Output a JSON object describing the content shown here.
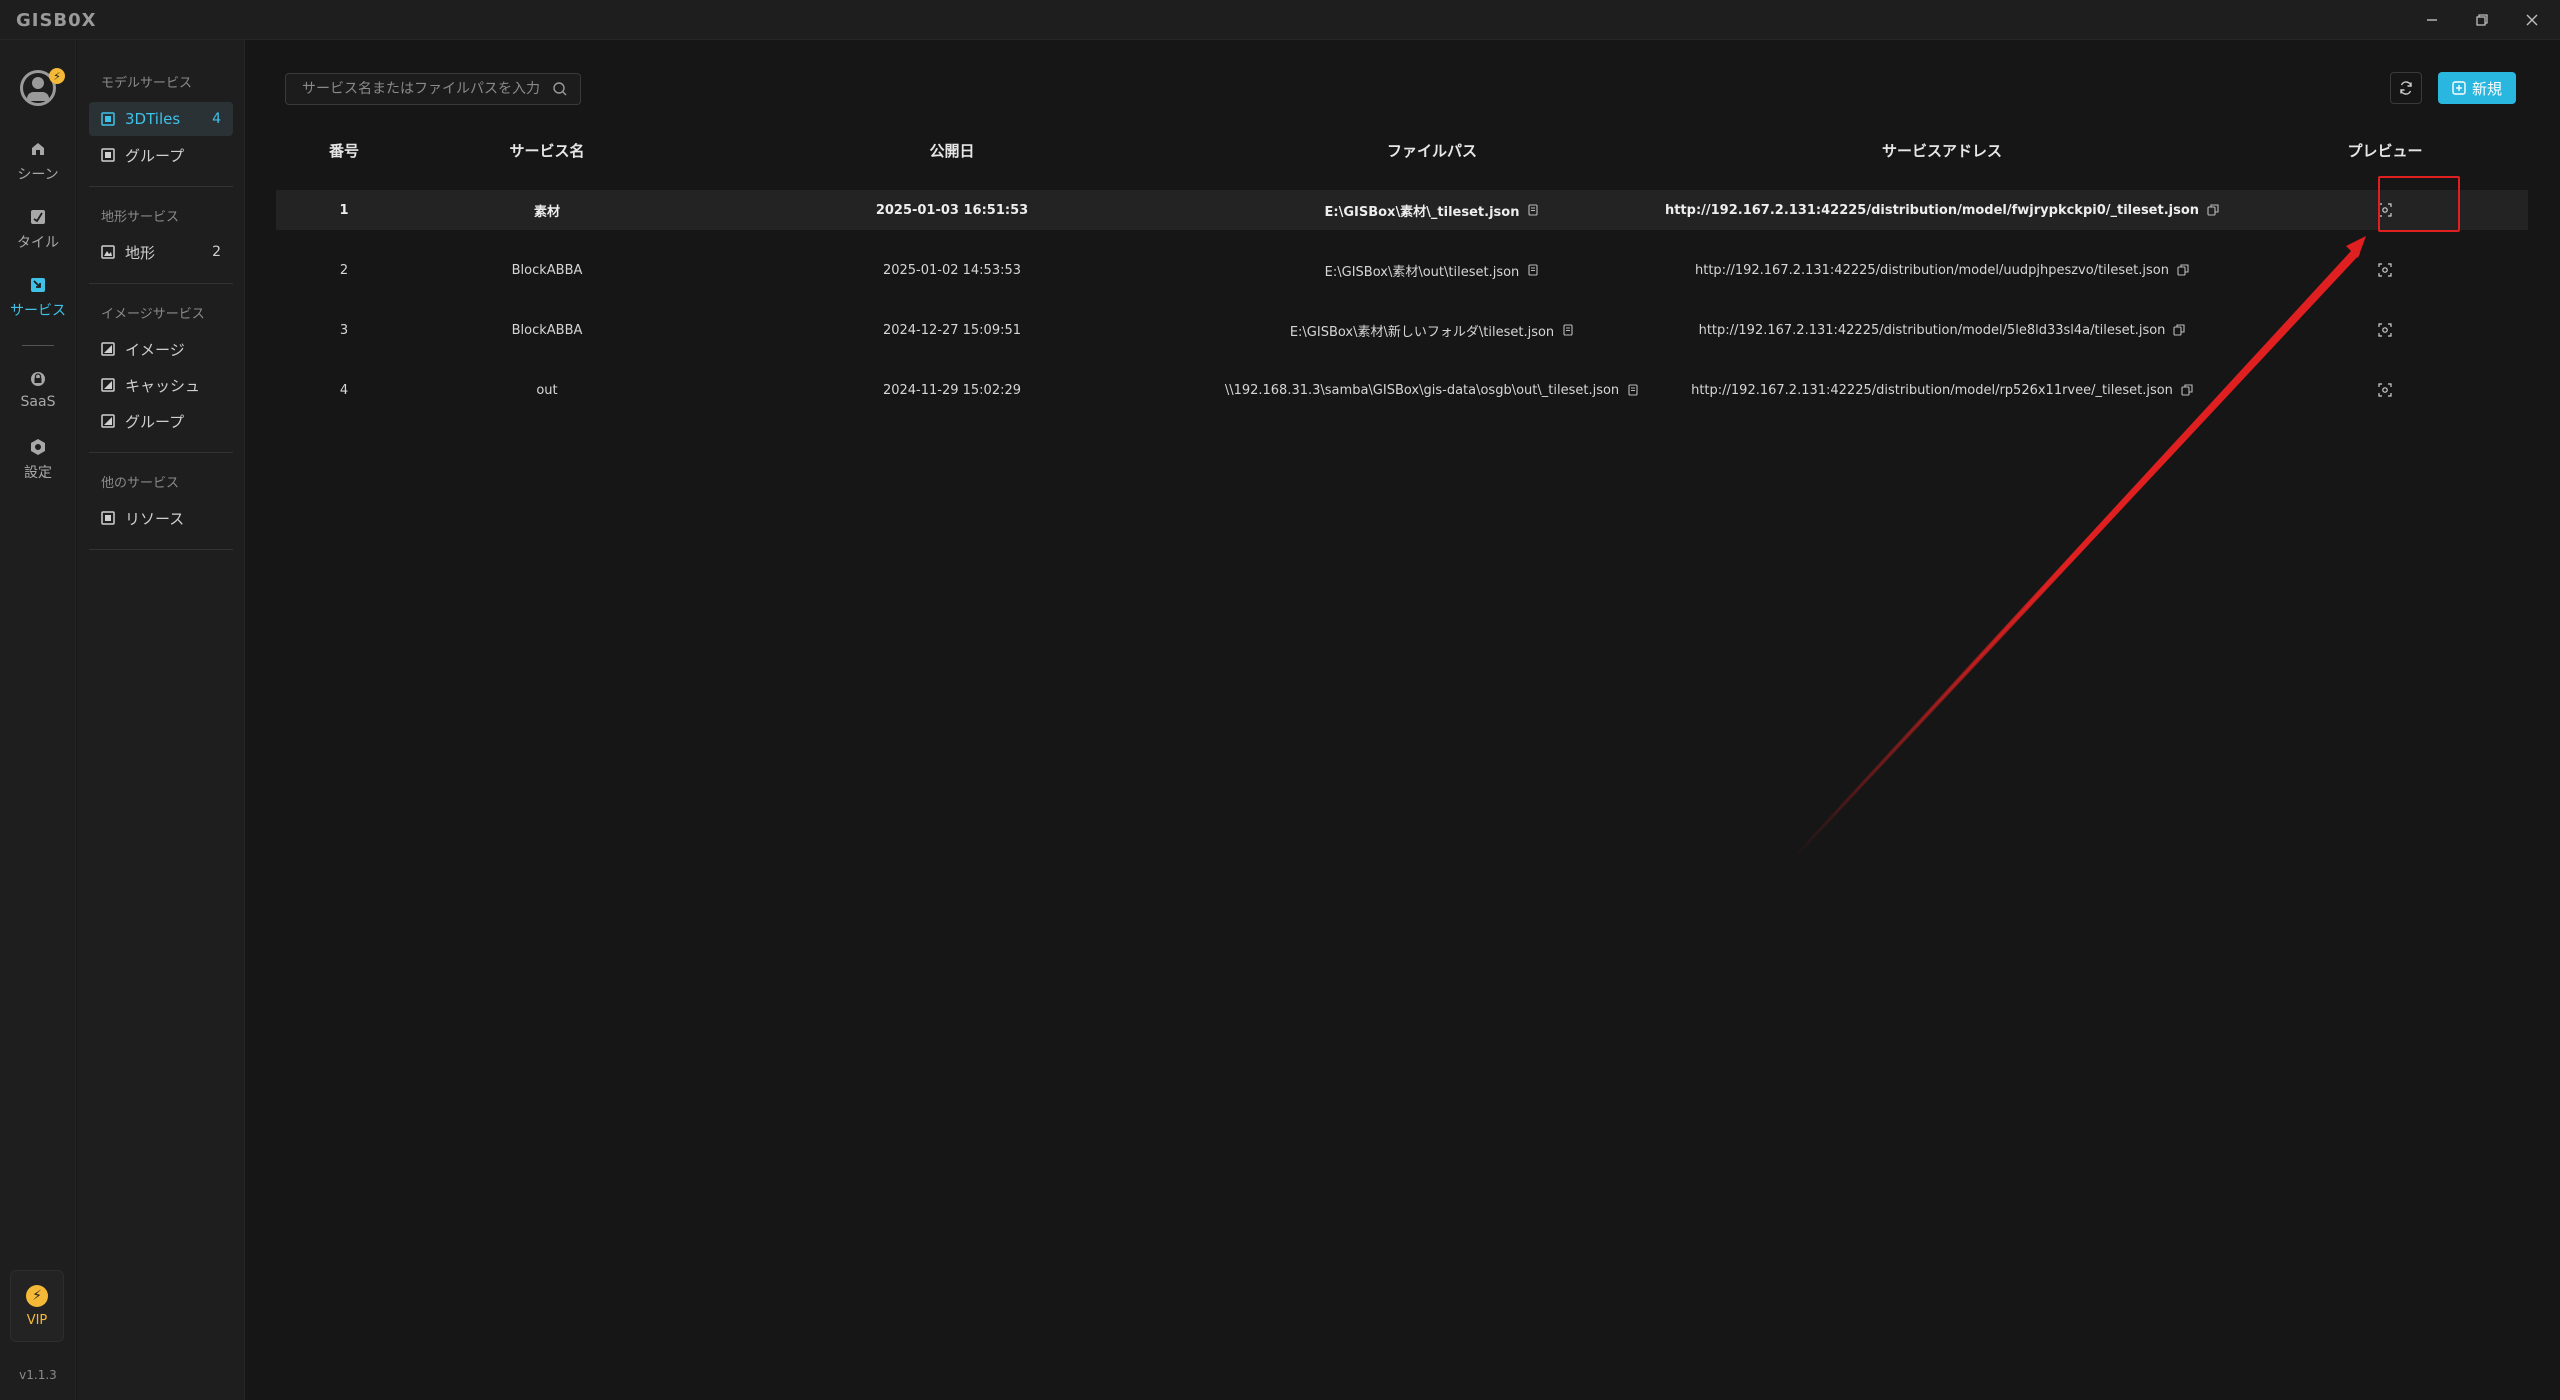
{
  "app": {
    "logo": "GISB0X",
    "version": "v1.1.3",
    "vip_label": "VIP",
    "avatar_badge": "⚡"
  },
  "rail": {
    "items": [
      {
        "label": "シーン",
        "icon": "scene-icon"
      },
      {
        "label": "タイル",
        "icon": "tile-icon"
      },
      {
        "label": "サービス",
        "icon": "service-icon",
        "active": true
      },
      {
        "label": "SaaS",
        "icon": "saas-icon"
      },
      {
        "label": "設定",
        "icon": "settings-icon"
      }
    ]
  },
  "sidebar": {
    "groups": [
      {
        "title": "モデルサービス",
        "items": [
          {
            "label": "3DTiles",
            "count": "4",
            "active": true
          },
          {
            "label": "グループ",
            "count": ""
          }
        ]
      },
      {
        "title": "地形サービス",
        "items": [
          {
            "label": "地形",
            "count": "2"
          }
        ]
      },
      {
        "title": "イメージサービス",
        "items": [
          {
            "label": "イメージ",
            "count": ""
          },
          {
            "label": "キャッシュ",
            "count": ""
          },
          {
            "label": "グループ",
            "count": ""
          }
        ]
      },
      {
        "title": "他のサービス",
        "items": [
          {
            "label": "リソース",
            "count": ""
          }
        ]
      }
    ]
  },
  "toolbar": {
    "search_placeholder": "サービス名またはファイルパスを入力",
    "new_label": "新規"
  },
  "table": {
    "headers": [
      "番号",
      "サービス名",
      "公開日",
      "ファイルパス",
      "サービスアドレス",
      "プレビュー"
    ],
    "rows": [
      {
        "no": "1",
        "name": "素材",
        "date": "2025-01-03 16:51:53",
        "path": "E:\\GISBox\\素材\\_tileset.json",
        "address": "http://192.167.2.131:42225/distribution/model/fwjrypkckpi0/_tileset.json"
      },
      {
        "no": "2",
        "name": "BlockABBA",
        "date": "2025-01-02 14:53:53",
        "path": "E:\\GISBox\\素材\\out\\tileset.json",
        "address": "http://192.167.2.131:42225/distribution/model/uudpjhpeszvo/tileset.json"
      },
      {
        "no": "3",
        "name": "BlockABBA",
        "date": "2024-12-27 15:09:51",
        "path": "E:\\GISBox\\素材\\新しいフォルダ\\tileset.json",
        "address": "http://192.167.2.131:42225/distribution/model/5le8ld33sl4a/tileset.json"
      },
      {
        "no": "4",
        "name": "out",
        "date": "2024-11-29 15:02:29",
        "path": "\\\\192.168.31.3\\samba\\GISBox\\gis-data\\osgb\\out\\_tileset.json",
        "address": "http://192.167.2.131:42225/distribution/model/rp526x11rvee/_tileset.json"
      }
    ]
  },
  "colors": {
    "accent": "#29b6df",
    "highlight": "#e02020",
    "vip": "#f5b938"
  }
}
